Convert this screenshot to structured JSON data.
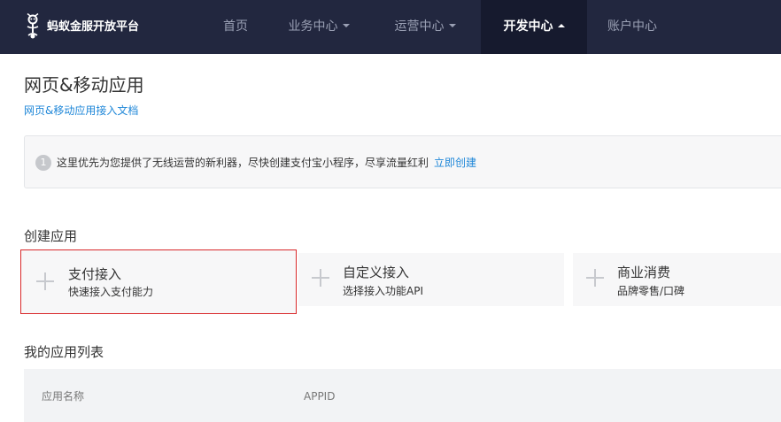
{
  "header": {
    "brand": "蚂蚁金服开放平台",
    "nav": [
      {
        "label": "首页"
      },
      {
        "label": "业务中心"
      },
      {
        "label": "运营中心"
      },
      {
        "label": "开发中心"
      },
      {
        "label": "账户中心"
      }
    ],
    "active_nav": "开发中心"
  },
  "main": {
    "title": "网页&移动应用",
    "doc_link": "网页&移动应用接入文档",
    "notice": {
      "number": "1",
      "text": "这里优先为您提供了无线运营的新利器，尽快创建支付宝小程序，尽享流量红利",
      "link": "立即创建"
    },
    "create_section": {
      "title": "创建应用",
      "cards": [
        {
          "title": "支付接入",
          "desc": "快速接入支付能力"
        },
        {
          "title": "自定义接入",
          "desc": "选择接入功能API"
        },
        {
          "title": "商业消费",
          "desc": "品牌零售/口碑"
        }
      ]
    },
    "app_list": {
      "title": "我的应用列表",
      "columns": [
        "应用名称",
        "APPID"
      ]
    }
  },
  "colors": {
    "topbar": "#22273f",
    "active_nav_bg": "#161a2e",
    "link": "#1f87d8",
    "selection_border": "#d9282a"
  }
}
